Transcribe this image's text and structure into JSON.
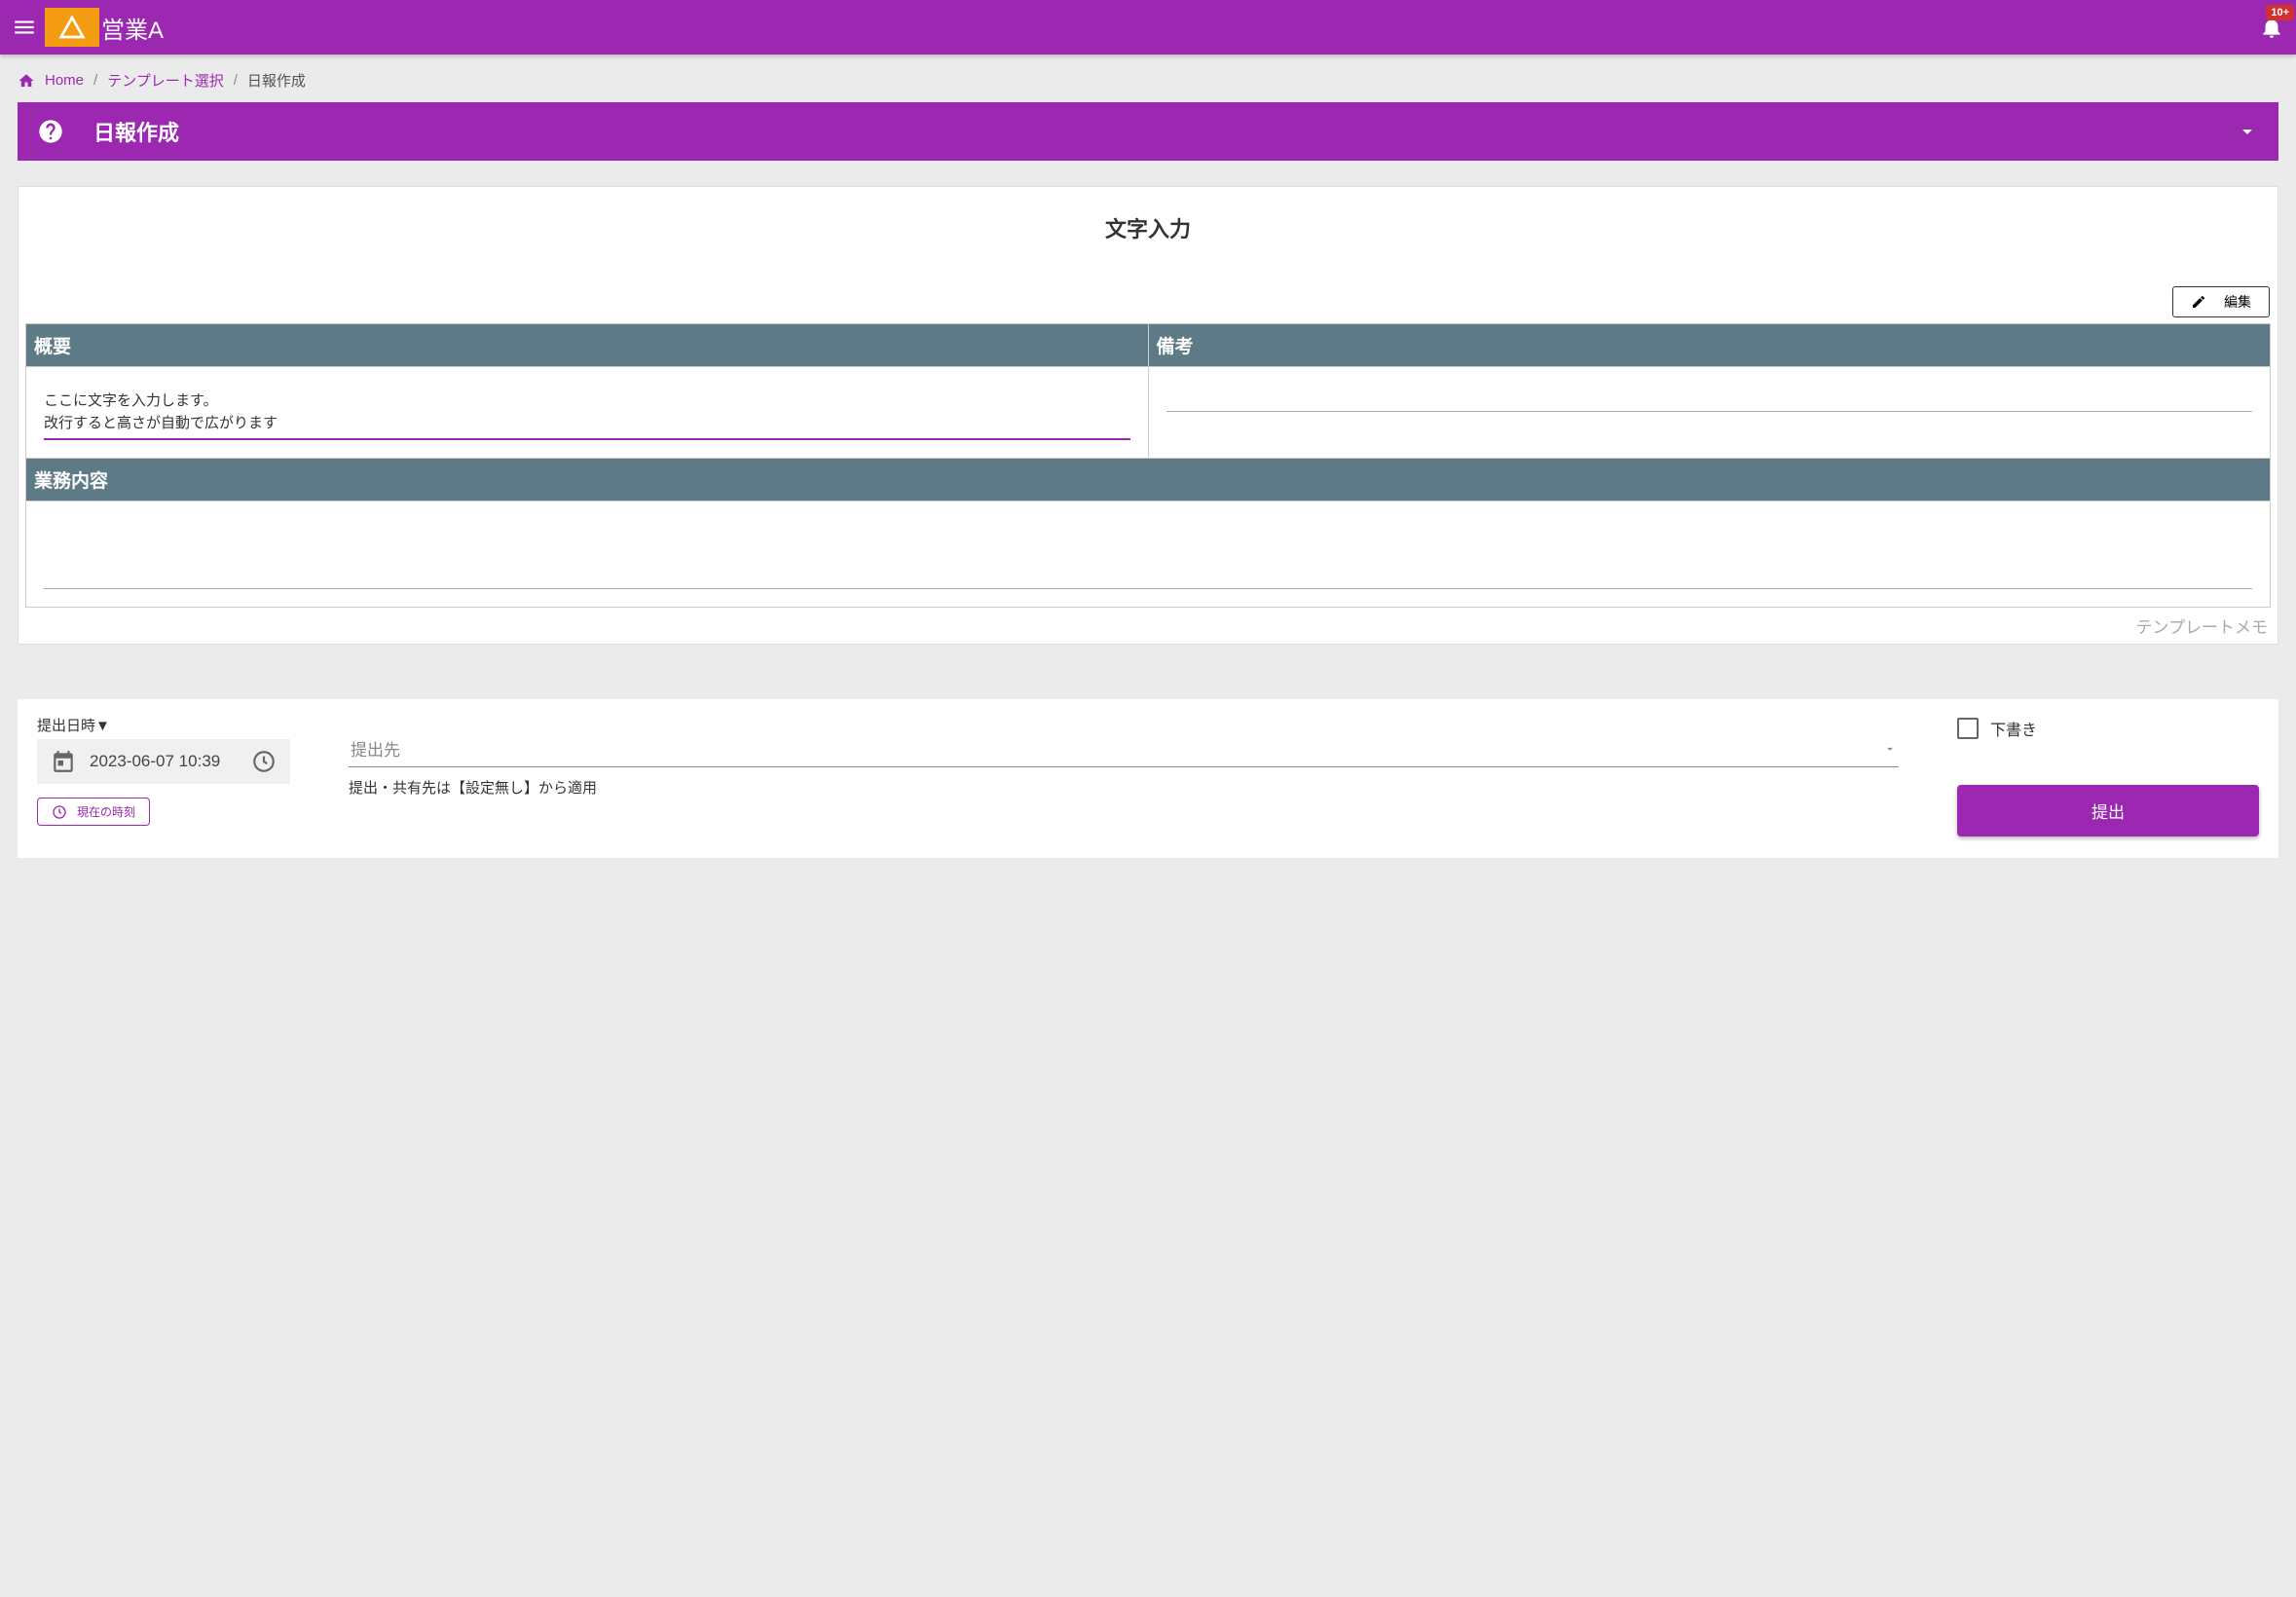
{
  "header": {
    "app_title": "営業A",
    "badge": "10+"
  },
  "breadcrumb": {
    "home": "Home",
    "template_select": "テンプレート選択",
    "current": "日報作成"
  },
  "section": {
    "title": "日報作成"
  },
  "card": {
    "title": "文字入力",
    "edit_label": "編集",
    "fields": {
      "summary_header": "概要",
      "remarks_header": "備考",
      "work_header": "業務内容",
      "summary_value": "ここに文字を入力します。\n改行すると高さが自動で広がります",
      "remarks_value": "",
      "work_value": ""
    },
    "template_memo": "テンプレートメモ"
  },
  "footer": {
    "datetime_label": "提出日時▼",
    "datetime_value": "2023-06-07 10:39",
    "now_button": "現在の時刻",
    "dest_placeholder": "提出先",
    "dest_help": "提出・共有先は【設定無し】から適用",
    "draft_label": "下書き",
    "submit_label": "提出"
  }
}
